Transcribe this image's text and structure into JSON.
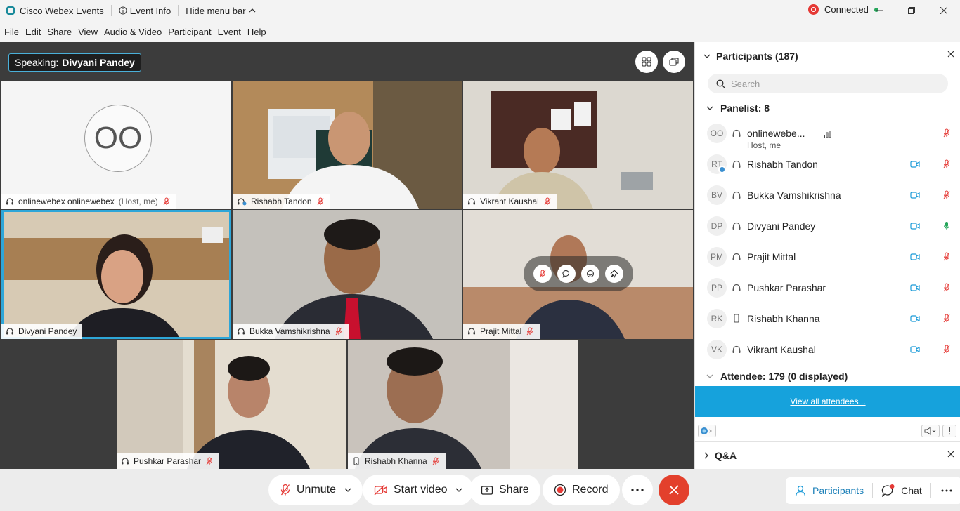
{
  "titlebar": {
    "app_title": "Cisco Webex Events",
    "event_info": "Event Info",
    "hide_menu": "Hide menu bar",
    "connection": "Connected"
  },
  "menu": [
    "File",
    "Edit",
    "Share",
    "View",
    "Audio & Video",
    "Participant",
    "Event",
    "Help"
  ],
  "stage": {
    "speaking_prefix": "Speaking:",
    "speaking_name": "Divyani Pandey",
    "tiles": [
      {
        "name": "onlinewebex onlinewebex",
        "tag": "(Host, me)",
        "initials": "OO"
      },
      {
        "name": "Rishabh Tandon"
      },
      {
        "name": "Vikrant Kaushal"
      },
      {
        "name": "Divyani Pandey"
      },
      {
        "name": "Bukka Vamshikrishna"
      },
      {
        "name": "Prajit Mittal"
      },
      {
        "name": "Pushkar Parashar"
      },
      {
        "name": "Rishabh Khanna"
      }
    ]
  },
  "panel": {
    "title": "Participants (187)",
    "search_placeholder": "Search",
    "panelist_header": "Panelist: 8",
    "panelists": [
      {
        "initials": "OO",
        "name": "onlinewebe...",
        "role": "Host, me"
      },
      {
        "initials": "RT",
        "name": "Rishabh Tandon"
      },
      {
        "initials": "BV",
        "name": "Bukka Vamshikrishna"
      },
      {
        "initials": "DP",
        "name": "Divyani Pandey"
      },
      {
        "initials": "PM",
        "name": "Prajit Mittal"
      },
      {
        "initials": "PP",
        "name": "Pushkar Parashar"
      },
      {
        "initials": "RK",
        "name": "Rishabh Khanna"
      },
      {
        "initials": "VK",
        "name": "Vikrant Kaushal"
      }
    ],
    "attendee_header": "Attendee: 179 (0 displayed)",
    "view_all": "View all attendees...",
    "qa_title": "Q&A"
  },
  "controls": {
    "unmute": "Unmute",
    "start_video": "Start video",
    "share": "Share",
    "record": "Record",
    "participants": "Participants",
    "chat": "Chat"
  },
  "colors": {
    "accent": "#16a2dc",
    "end_call": "#e3402c",
    "muted_mic": "#e53935",
    "active_mic": "#26a65b",
    "video_icon": "#1a9ad8"
  }
}
